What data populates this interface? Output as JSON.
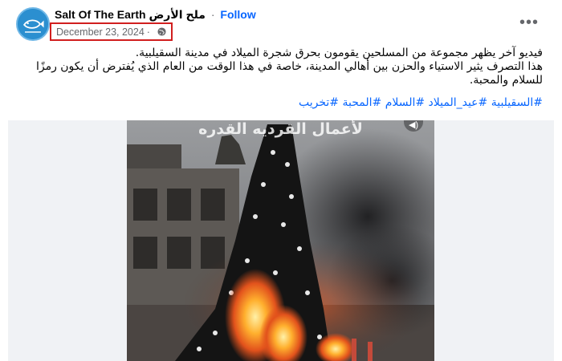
{
  "post": {
    "author": "Salt Of The Earth ملح الأرض",
    "separator": "·",
    "follow_label": "Follow",
    "date": "December 23, 2024",
    "privacy_icon": "globe-icon",
    "more_label": "•••",
    "text_lines": [
      "فيديو آخر يظهر مجموعة من المسلحين يقومون بحرق شجرة الميلاد في مدينة السقيلبية.",
      "هذا التصرف يثير الاستياء والحزن بين أهالي المدينة، خاصة في هذا الوقت من العام الذي يُفترض أن يكون رمزًا",
      "للسلام والمحبة."
    ],
    "hashtags": [
      "#السقيلبية",
      "#عيد_الميلاد",
      "#السلام",
      "#المحبة",
      "#تخريب"
    ]
  },
  "video": {
    "caption": "لأعمال القرديه القدره",
    "mute_icon": "speaker-icon",
    "mute_symbol": "◀)"
  },
  "colors": {
    "accent": "#0866ff",
    "highlight_box": "#d11f1f",
    "muted_text": "#65676b"
  }
}
